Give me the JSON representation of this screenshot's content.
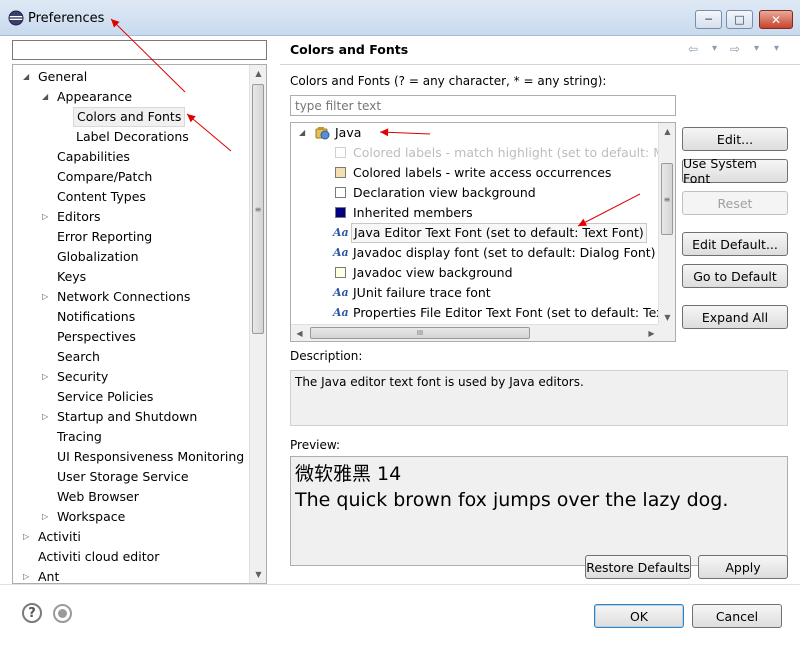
{
  "window": {
    "title": "Preferences",
    "min_glyph": "─",
    "max_glyph": "□",
    "close_glyph": "✕"
  },
  "sidebar": {
    "filter_value": "",
    "scrollbar": {
      "up_glyph": "▲",
      "down_glyph": "▼",
      "thumb_glyph": "≡"
    },
    "items": [
      {
        "label": "General",
        "level": 0,
        "twist": "◢"
      },
      {
        "label": "Appearance",
        "level": 1,
        "twist": "◢"
      },
      {
        "label": "Colors and Fonts",
        "level": 2,
        "twist": "",
        "selected": true
      },
      {
        "label": "Label Decorations",
        "level": 2,
        "twist": ""
      },
      {
        "label": "Capabilities",
        "level": 1,
        "twist": ""
      },
      {
        "label": "Compare/Patch",
        "level": 1,
        "twist": ""
      },
      {
        "label": "Content Types",
        "level": 1,
        "twist": ""
      },
      {
        "label": "Editors",
        "level": 1,
        "twist": "▷"
      },
      {
        "label": "Error Reporting",
        "level": 1,
        "twist": ""
      },
      {
        "label": "Globalization",
        "level": 1,
        "twist": ""
      },
      {
        "label": "Keys",
        "level": 1,
        "twist": ""
      },
      {
        "label": "Network Connections",
        "level": 1,
        "twist": "▷"
      },
      {
        "label": "Notifications",
        "level": 1,
        "twist": ""
      },
      {
        "label": "Perspectives",
        "level": 1,
        "twist": ""
      },
      {
        "label": "Search",
        "level": 1,
        "twist": ""
      },
      {
        "label": "Security",
        "level": 1,
        "twist": "▷"
      },
      {
        "label": "Service Policies",
        "level": 1,
        "twist": ""
      },
      {
        "label": "Startup and Shutdown",
        "level": 1,
        "twist": "▷"
      },
      {
        "label": "Tracing",
        "level": 1,
        "twist": ""
      },
      {
        "label": "UI Responsiveness Monitoring",
        "level": 1,
        "twist": ""
      },
      {
        "label": "User Storage Service",
        "level": 1,
        "twist": ""
      },
      {
        "label": "Web Browser",
        "level": 1,
        "twist": ""
      },
      {
        "label": "Workspace",
        "level": 1,
        "twist": "▷"
      },
      {
        "label": "Activiti",
        "level": 0,
        "twist": "▷"
      },
      {
        "label": "Activiti cloud editor",
        "level": 0,
        "twist": ""
      },
      {
        "label": "Ant",
        "level": 0,
        "twist": "▷"
      }
    ]
  },
  "page": {
    "title": "Colors and Fonts",
    "nav": {
      "back": "⇦",
      "back_menu": "▾",
      "forward": "⇨",
      "forward_menu": "▾",
      "view_menu": "▾"
    },
    "filter_label": "Colors and Fonts (? = any character, * = any string):",
    "filter_placeholder": "type filter text",
    "tree": {
      "root_label": "Java",
      "root_twist": "◢",
      "items": [
        {
          "label": "Colored labels - match highlight (set to default: Mat",
          "kind": "swatch",
          "color": "#ffffff",
          "disabled": true
        },
        {
          "label": "Colored labels - write access occurrences",
          "kind": "swatch",
          "color": "#f4dfb3"
        },
        {
          "label": "Declaration view background",
          "kind": "swatch",
          "color": "#ffffff"
        },
        {
          "label": "Inherited members",
          "kind": "swatch",
          "color": "#000080"
        },
        {
          "label": "Java Editor Text Font (set to default: Text Font)",
          "kind": "font",
          "selected": true
        },
        {
          "label": "Javadoc display font (set to default: Dialog Font)",
          "kind": "font"
        },
        {
          "label": "Javadoc view background",
          "kind": "swatch",
          "color": "#ffffe1"
        },
        {
          "label": "JUnit failure trace font",
          "kind": "font"
        },
        {
          "label": "Properties File Editor Text Font (set to default: Text F",
          "kind": "font"
        }
      ],
      "font_icon_text": "Aa",
      "scroll": {
        "up_glyph": "▲",
        "down_glyph": "▼",
        "left_glyph": "◀",
        "right_glyph": "▶",
        "thumb_glyph": "≡",
        "hthumb_glyph": "III"
      }
    },
    "buttons": {
      "edit": "Edit...",
      "use_system_font": "Use System Font",
      "reset": "Reset",
      "edit_default": "Edit Default...",
      "go_to_default": "Go to Default",
      "expand_all": "Expand All"
    },
    "description_label": "Description:",
    "description_text": "The Java editor text font is used by Java editors.",
    "preview_label": "Preview:",
    "preview_line1": "微软雅黑 14",
    "preview_line2": "The quick brown fox jumps over the lazy dog.",
    "restore_defaults": "Restore Defaults",
    "apply": "Apply"
  },
  "footer": {
    "help_glyph": "?",
    "ok": "OK",
    "cancel": "Cancel"
  },
  "colors": {
    "annotation_arrow": "#e00000"
  }
}
